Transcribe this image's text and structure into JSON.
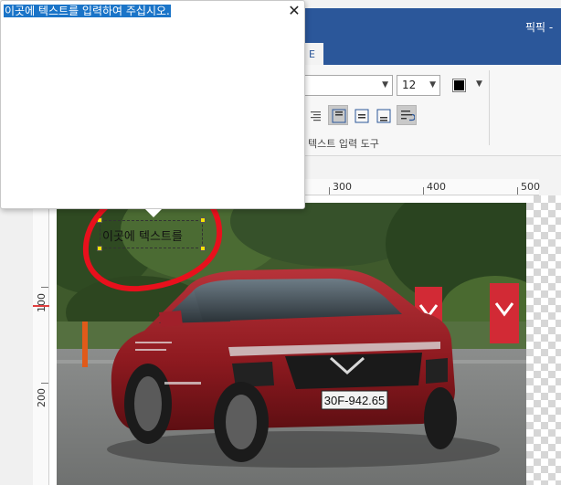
{
  "window": {
    "title": "픽픽 -"
  },
  "ribbon": {
    "font_size": "12",
    "text_color": "#000000",
    "group_label": "텍스트 입력 도구",
    "align_buttons": [
      "align-right",
      "align-top",
      "align-middle",
      "align-bottom",
      "auto-wrap"
    ]
  },
  "ruler": {
    "top_labels": [
      "300",
      "400",
      "500"
    ],
    "left_labels": [
      "100",
      "200"
    ]
  },
  "canvas": {
    "text_object": "이곳에 텍스트를"
  },
  "popup": {
    "text": "이곳에 텍스트를 입력하여 주십시오.",
    "close_glyph": "✕"
  },
  "photo": {
    "plate_text": "30F-942.65"
  },
  "colors": {
    "titlebar": "#2b579a",
    "selection": "#1a74c8",
    "annotation": "#e8101c",
    "car": "#9b1c20"
  }
}
